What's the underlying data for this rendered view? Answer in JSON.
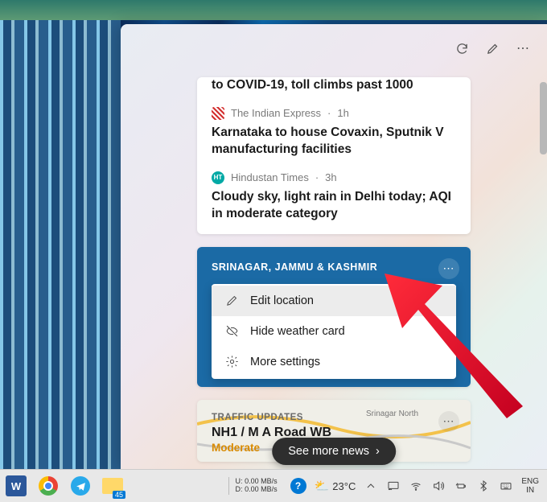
{
  "header": {},
  "news": {
    "top_headline": "to COVID-19, toll climbs past 1000",
    "items": [
      {
        "source": "The Indian Express",
        "age": "1h",
        "headline": "Karnataka to house Covaxin, Sputnik V manufacturing facilities"
      },
      {
        "source": "Hindustan Times",
        "age": "3h",
        "headline": "Cloudy sky, light rain in Delhi today; AQI in moderate category"
      }
    ]
  },
  "weather": {
    "location": "SRINAGAR, JAMMU & KASHMIR",
    "menu": {
      "edit": "Edit location",
      "hide": "Hide weather card",
      "more": "More settings"
    }
  },
  "traffic": {
    "label": "TRAFFIC UPDATES",
    "road": "NH1 / M A Road WB",
    "status": "Moderate"
  },
  "see_more": "See more news",
  "taskbar": {
    "net_u_label": "U:",
    "net_u_val": "0.00 MB/s",
    "net_d_label": "D:",
    "net_d_val": "0.00 MB/s",
    "temp": "23°C",
    "lang1": "ENG",
    "lang2": "IN",
    "badge": "45"
  }
}
